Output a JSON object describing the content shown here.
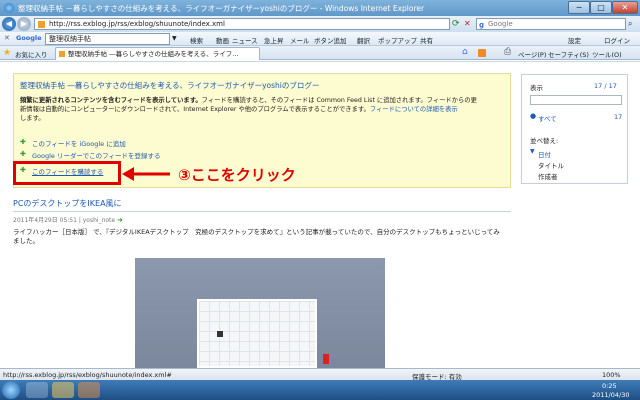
{
  "window": {
    "title": "整理収納手帖 －暮らしやすさの仕組みを考える、ライフオーガナイザーyoshiのブログー - Windows Internet Explorer",
    "minimize": "─",
    "maximize": "□",
    "close": "✕"
  },
  "address_bar": {
    "url": "http://rss.exblog.jp/rss/exblog/shuunote/index.xml",
    "search_placeholder": "Google"
  },
  "google_toolbar": {
    "brand": "Google",
    "search_text": "整理収納手帖",
    "items": [
      "検索",
      "動画",
      "ニュース",
      "急上昇",
      "メール",
      "ボタン追加",
      "翻訳",
      "ポップアップ",
      "共有",
      "設定",
      "ログイン"
    ]
  },
  "tab_row": {
    "favorites": "お気に入り",
    "tab_label": "整理収納手帖 ―暮らしやすさの仕組みを考える、ライフ...",
    "commands": [
      "ページ(P)",
      "セーフティ(S)",
      "ツール(O)"
    ]
  },
  "feed": {
    "title": "整理収納手帖 ―暮らしやすさの仕組みを考える、ライフオーガナイザーyoshiのブログー",
    "desc_bold": "頻繁に更新されるコンテンツを含むフィードを表示しています。",
    "desc_1": "フィードを購読すると、そのフィードは Common Feed List に追加されます。フィードからの更",
    "desc_2": "新情報は自動的にコンピューターにダウンロードされて、Internet Explorer や他のプログラムで表示することができます。",
    "desc_link": "フィードについての詳細を表示",
    "desc_3": "します。",
    "links": [
      "このフィードを iGoogle に追加",
      "Google リーダーでこのフィードを登録する",
      "このフィードを購読する"
    ]
  },
  "annotation": "③ここをクリック",
  "sidebar": {
    "display_label": "表示",
    "count": "17 / 17",
    "all_label": "すべて",
    "all_count": "17",
    "sort_label": "並べ替え:",
    "sort_options": [
      "日付",
      "タイトル",
      "作成者"
    ]
  },
  "post": {
    "title": "PCのデスクトップをIKEA風に",
    "date": "2011年4月29日 05:51 | yoshi_note",
    "body_1": "ライフハッカー［日本版］ で、『デジタルIKEAデスクトップ　究極のデスクトップを求めて』という記事が載っていたので、自分のデスクトップもちょっといじってみ",
    "body_2": "ました。"
  },
  "status_bar": {
    "url": "http://rss.exblog.jp/rss/exblog/shuunote/index.xml#",
    "protected_mode": "保護モード: 有効",
    "zoom": "100%"
  },
  "taskbar": {
    "time": "0:25",
    "date": "2011/04/30"
  },
  "colors": {
    "annotation": "#e00000",
    "link": "#1b5ab3",
    "feed_bg": "#fdfbd0"
  }
}
